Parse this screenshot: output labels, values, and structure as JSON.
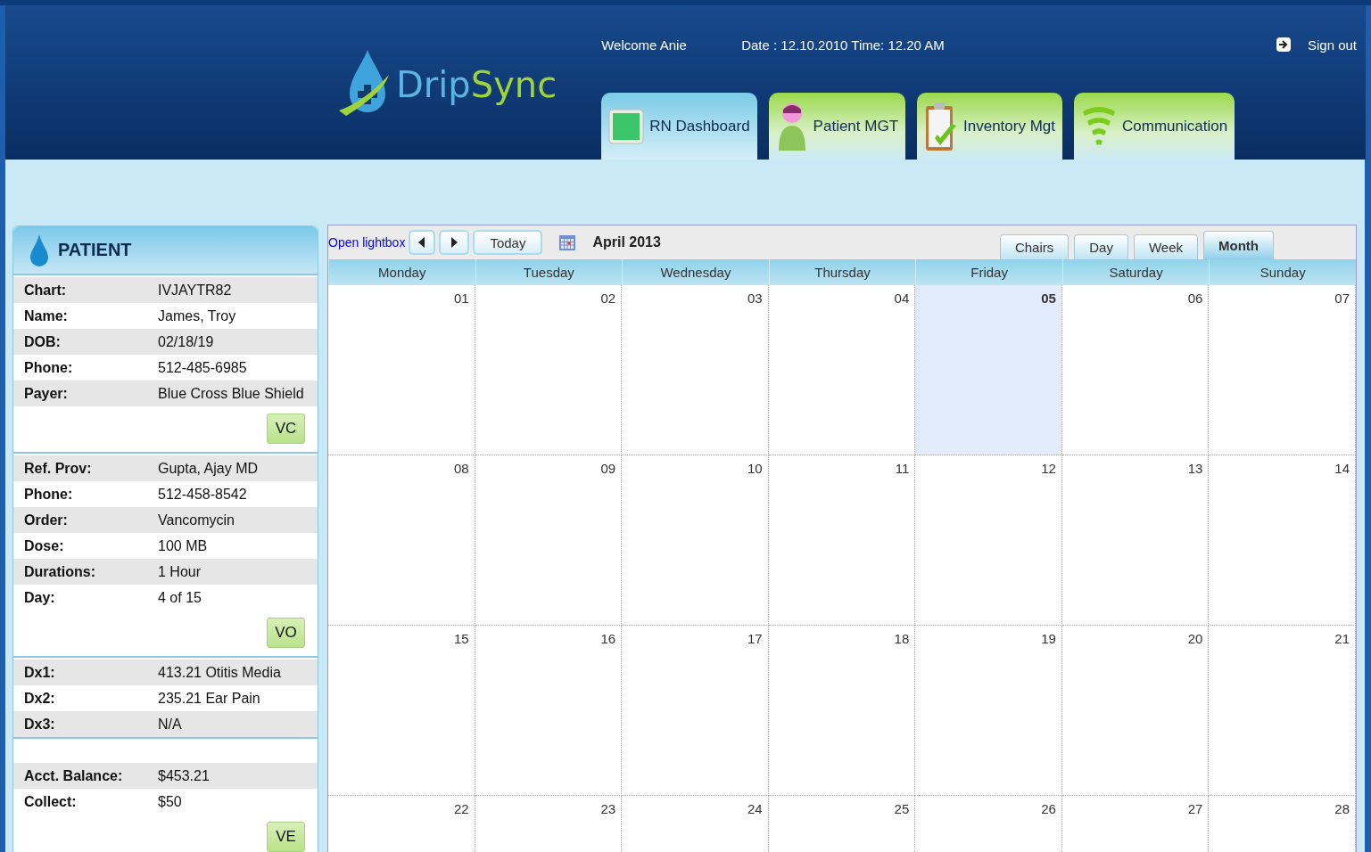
{
  "header": {
    "logo": {
      "part1": "Drip",
      "part2": "Sync"
    },
    "welcome": "Welcome Anie",
    "datetime": "Date : 12.10.2010 Time: 12.20 AM",
    "sign_out": "Sign out"
  },
  "nav_tabs": [
    {
      "label": "RN Dashboard",
      "kind": "dashboard",
      "selected": true
    },
    {
      "label": "Patient MGT",
      "kind": "patient",
      "selected": false
    },
    {
      "label": "Inventory Mgt",
      "kind": "inventory",
      "selected": false
    },
    {
      "label": "Communication",
      "kind": "communication",
      "selected": false
    }
  ],
  "patient_panel": {
    "title": "PATIENT",
    "sections": [
      {
        "rows": [
          {
            "label": "Chart:",
            "value": "IVJAYTR82"
          },
          {
            "label": "Name:",
            "value": "James, Troy"
          },
          {
            "label": "DOB:",
            "value": "02/18/19"
          },
          {
            "label": "Phone:",
            "value": "512-485-6985"
          },
          {
            "label": "Payer:",
            "value": "Blue Cross Blue Shield"
          }
        ],
        "button": "VC"
      },
      {
        "rows": [
          {
            "label": "Ref. Prov:",
            "value": "Gupta, Ajay MD"
          },
          {
            "label": "Phone:",
            "value": "512-458-8542"
          },
          {
            "label": "Order:",
            "value": "Vancomycin"
          },
          {
            "label": "Dose:",
            "value": "100 MB"
          },
          {
            "label": "Durations:",
            "value": "1 Hour"
          },
          {
            "label": "Day:",
            "value": "4 of 15"
          }
        ],
        "button": "VO"
      },
      {
        "rows": [
          {
            "label": "Dx1:",
            "value": "413.21 Otitis Media"
          },
          {
            "label": "Dx2:",
            "value": "235.21 Ear Pain"
          },
          {
            "label": "Dx3:",
            "value": "N/A"
          }
        ]
      },
      {
        "rows": [
          {
            "label": "Acct. Balance:",
            "value": "$453.21"
          },
          {
            "label": "Collect:",
            "value": "$50"
          }
        ],
        "button": "VE"
      }
    ]
  },
  "calendar": {
    "lightbox_link": "Open lightbox",
    "today_button": "Today",
    "month_title": "April 2013",
    "view_tabs": [
      {
        "label": "Chairs",
        "selected": false
      },
      {
        "label": "Day",
        "selected": false
      },
      {
        "label": "Week",
        "selected": false
      },
      {
        "label": "Month",
        "selected": true
      }
    ],
    "weekdays": [
      "Monday",
      "Tuesday",
      "Wednesday",
      "Thursday",
      "Friday",
      "Saturday",
      "Sunday"
    ],
    "weeks": [
      [
        {
          "day": "01",
          "today": false
        },
        {
          "day": "02",
          "today": false
        },
        {
          "day": "03",
          "today": false
        },
        {
          "day": "04",
          "today": false
        },
        {
          "day": "05",
          "today": true
        },
        {
          "day": "06",
          "today": false
        },
        {
          "day": "07",
          "today": false
        }
      ],
      [
        {
          "day": "08",
          "today": false
        },
        {
          "day": "09",
          "today": false
        },
        {
          "day": "10",
          "today": false
        },
        {
          "day": "11",
          "today": false
        },
        {
          "day": "12",
          "today": false
        },
        {
          "day": "13",
          "today": false
        },
        {
          "day": "14",
          "today": false
        }
      ],
      [
        {
          "day": "15",
          "today": false
        },
        {
          "day": "16",
          "today": false
        },
        {
          "day": "17",
          "today": false
        },
        {
          "day": "18",
          "today": false
        },
        {
          "day": "19",
          "today": false
        },
        {
          "day": "20",
          "today": false
        },
        {
          "day": "21",
          "today": false
        }
      ],
      [
        {
          "day": "22",
          "today": false
        },
        {
          "day": "23",
          "today": false
        },
        {
          "day": "24",
          "today": false
        },
        {
          "day": "25",
          "today": false
        },
        {
          "day": "26",
          "today": false
        },
        {
          "day": "27",
          "today": false
        },
        {
          "day": "28",
          "today": false
        }
      ]
    ]
  }
}
